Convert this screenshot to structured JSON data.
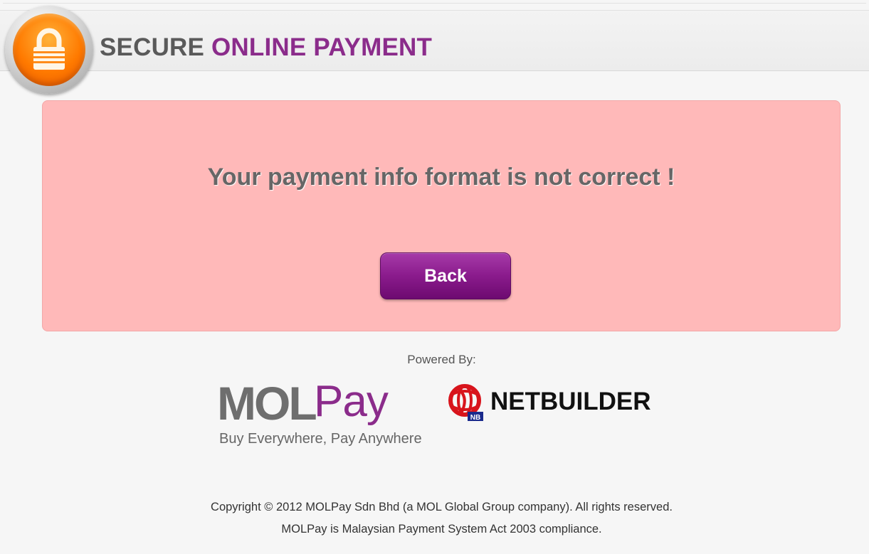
{
  "header": {
    "title_part1": "SECURE",
    "title_part2": "ONLINE PAYMENT",
    "icon": "lock-icon",
    "accent_color": "#8b2c8b"
  },
  "alert": {
    "message": "Your payment info format is not correct !",
    "back_label": "Back",
    "background_color": "#ffb9b9"
  },
  "footer": {
    "powered_by": "Powered By:",
    "molpay_mol": "MOL",
    "molpay_pay": "Pay",
    "molpay_tagline": "Buy Everywhere, Pay Anywhere",
    "netbuilder": "NETBUILDER",
    "copyright_line1": "Copyright © 2012 MOLPay Sdn Bhd (a MOL Global Group company). All rights reserved.",
    "copyright_line2": "MOLPay is Malaysian Payment System Act 2003 compliance."
  }
}
